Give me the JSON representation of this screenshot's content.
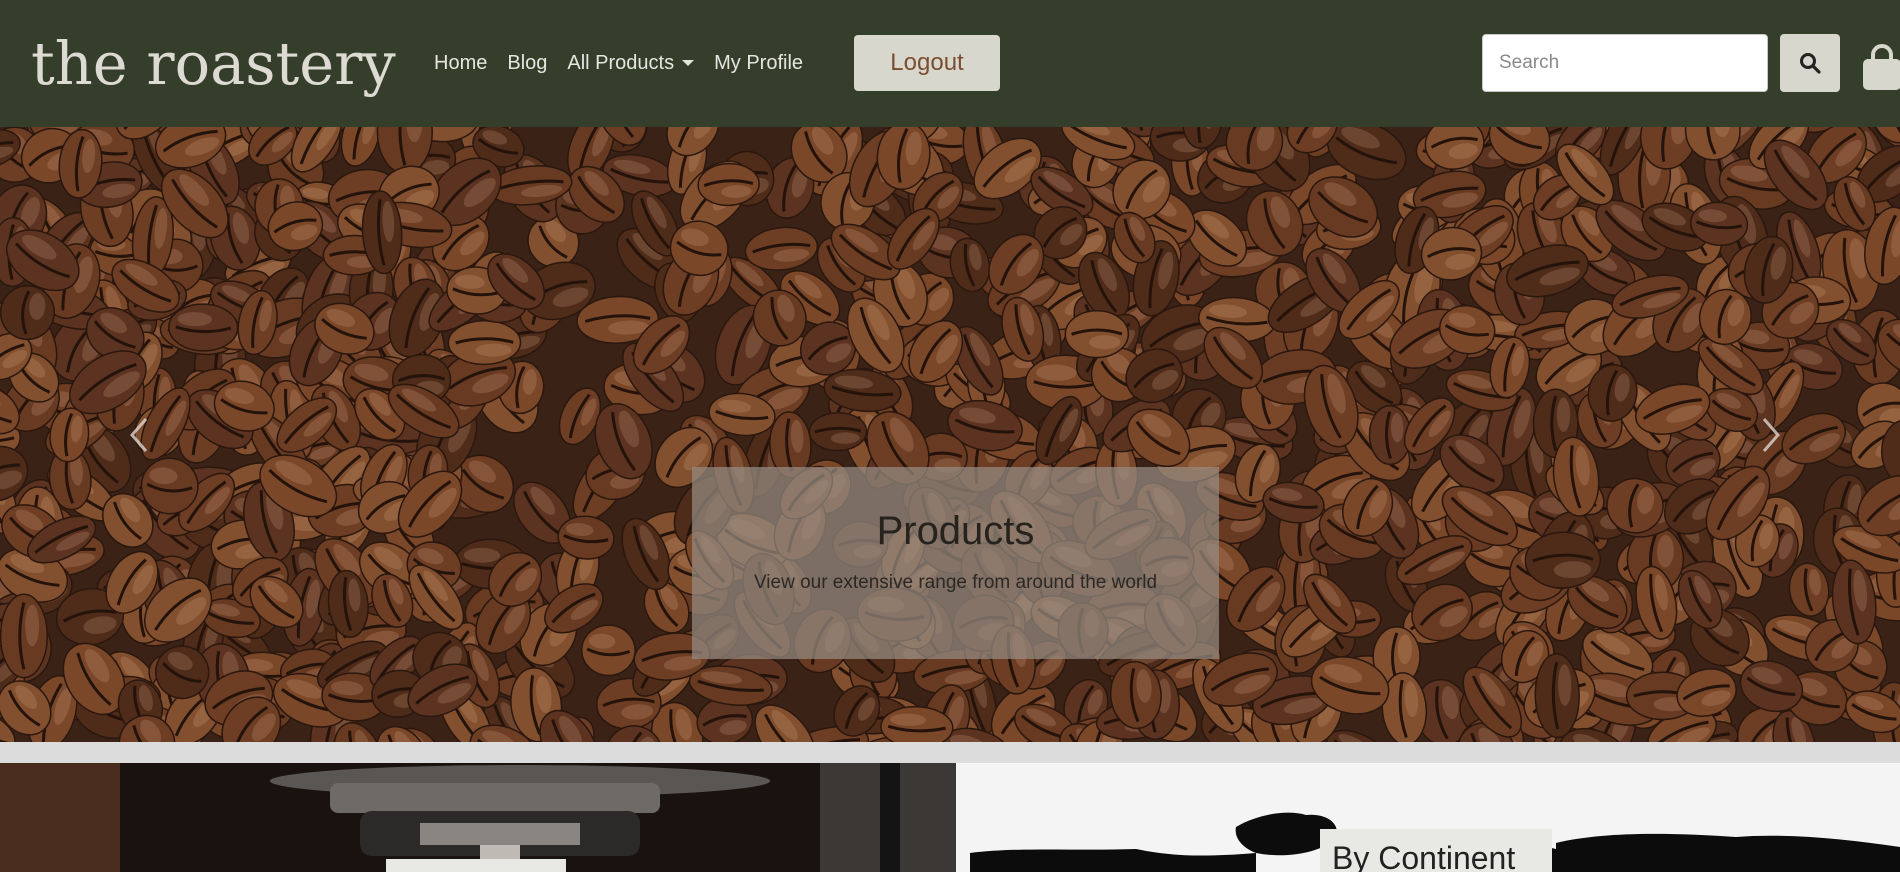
{
  "brand": {
    "name": "the roastery"
  },
  "nav": {
    "items": [
      {
        "label": "Home"
      },
      {
        "label": "Blog"
      },
      {
        "label": "All Products"
      },
      {
        "label": "My Profile"
      }
    ],
    "logout_label": "Logout"
  },
  "search": {
    "placeholder": "Search",
    "button_icon": "search-icon"
  },
  "cart": {
    "icon": "shopping-bag-icon"
  },
  "hero": {
    "caption_title": "Products",
    "caption_text": "View our extensive range from around the world",
    "prev_icon": "chevron-left-icon",
    "next_icon": "chevron-right-icon"
  },
  "cards": {
    "right_title": "By Continent"
  },
  "colors": {
    "navbar": "#343e2b",
    "button": "#d7d7cd",
    "logout_text": "#7a4e2f",
    "brand_text": "#dcdad2"
  }
}
